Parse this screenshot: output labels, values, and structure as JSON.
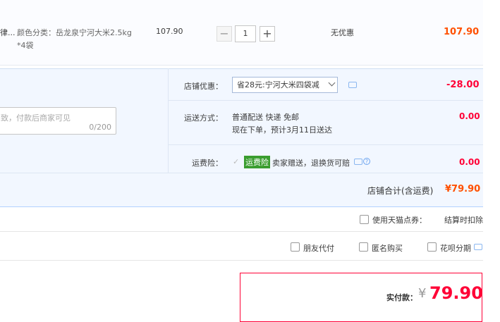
{
  "item": {
    "title_snippet": "律...",
    "sku_line1": "颜色分类：岳龙泉宁河大米2.5kg",
    "sku_line2": "*4袋",
    "unit_price": "107.90",
    "quantity": "1",
    "minus": "−",
    "plus": "+",
    "promo": "无优惠",
    "subtotal": "107.90"
  },
  "shop": {
    "discount_label": "店铺优惠：",
    "discount_selected": "省28元:宁河大米四袋减",
    "discount_amount": "-28.00",
    "message_placeholder": "致，付款后商家可见",
    "message_counter": "0/200",
    "shipping_label": "运送方式：",
    "shipping_method": "普通配送 快递 免邮",
    "shipping_eta": "现在下单，预计3月11日送达",
    "shipping_cost": "0.00",
    "insurance_label": "运费险：",
    "insurance_tag": "运费险",
    "insurance_text": "卖家赠送，退换货可赔",
    "insurance_cost": "0.00",
    "total_label": "店铺合计(含运费)",
    "total_value": "¥79.90"
  },
  "options": {
    "tmall_points_label": "使用天猫点券：",
    "tmall_points_note": "结算时扣除",
    "friend_pay": "朋友代付",
    "anonymous": "匿名购买",
    "huabei": "花呗分期"
  },
  "payment": {
    "label": "实付款：",
    "currency": "¥",
    "amount": "79.90"
  },
  "colors": {
    "accent_red": "#ff0036",
    "panel_blue": "#f2f7ff",
    "tag_green": "#3a9d2f"
  }
}
